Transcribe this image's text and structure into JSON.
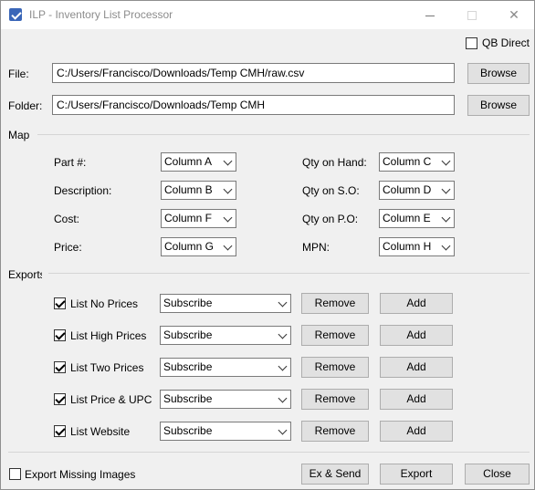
{
  "window": {
    "title": "ILP - Inventory List Processor",
    "icon": "checklist-icon"
  },
  "qb_direct": {
    "label": "QB Direct",
    "checked": false
  },
  "file": {
    "label": "File:",
    "value": "C:/Users/Francisco/Downloads/Temp CMH/raw.csv",
    "browse_label": "Browse"
  },
  "folder": {
    "label": "Folder:",
    "value": "C:/Users/Francisco/Downloads/Temp CMH",
    "browse_label": "Browse"
  },
  "map": {
    "title": "Map",
    "left": [
      {
        "label": "Part #:",
        "value": "Column A"
      },
      {
        "label": "Description:",
        "value": "Column B"
      },
      {
        "label": "Cost:",
        "value": "Column F"
      },
      {
        "label": "Price:",
        "value": "Column G"
      }
    ],
    "right": [
      {
        "label": "Qty on Hand:",
        "value": "Column C"
      },
      {
        "label": "Qty on S.O:",
        "value": "Column D"
      },
      {
        "label": "Qty on P.O:",
        "value": "Column E"
      },
      {
        "label": "MPN:",
        "value": "Column H"
      }
    ]
  },
  "exports": {
    "title": "Exports",
    "rows": [
      {
        "label": "List No Prices",
        "checked": true,
        "list": "Subscribe",
        "remove": "Remove",
        "add": "Add"
      },
      {
        "label": "List High Prices",
        "checked": true,
        "list": "Subscribe",
        "remove": "Remove",
        "add": "Add"
      },
      {
        "label": "List Two Prices",
        "checked": true,
        "list": "Subscribe",
        "remove": "Remove",
        "add": "Add"
      },
      {
        "label": "List Price & UPC",
        "checked": true,
        "list": "Subscribe",
        "remove": "Remove",
        "add": "Add"
      },
      {
        "label": "List Website",
        "checked": true,
        "list": "Subscribe",
        "remove": "Remove",
        "add": "Add"
      }
    ]
  },
  "footer": {
    "export_missing": {
      "label": "Export Missing Images",
      "checked": false
    },
    "ex_send": "Ex & Send",
    "export": "Export",
    "close": "Close"
  }
}
